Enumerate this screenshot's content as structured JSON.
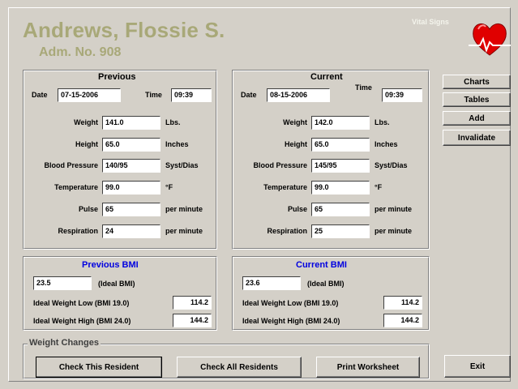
{
  "header": {
    "name": "Andrews, Flossie S.",
    "adm": "Adm. No. 908",
    "vital_signs": "Vital Signs"
  },
  "previous": {
    "title": "Previous",
    "date_label": "Date",
    "date": "07-15-2006",
    "time_label": "Time",
    "time": "09:39",
    "weight_label": "Weight",
    "weight": "141.0",
    "weight_unit": "Lbs.",
    "height_label": "Height",
    "height": "65.0",
    "height_unit": "Inches",
    "bp_label": "Blood Pressure",
    "bp": "140/95",
    "bp_unit": "Syst/Dias",
    "temp_label": "Temperature",
    "temp": "99.0",
    "temp_unit": "°F",
    "pulse_label": "Pulse",
    "pulse": "65",
    "pulse_unit": "per minute",
    "resp_label": "Respiration",
    "resp": "24",
    "resp_unit": "per minute"
  },
  "current": {
    "title": "Current",
    "date_label": "Date",
    "date": "08-15-2006",
    "time_label": "Time",
    "time": "09:39",
    "weight_label": "Weight",
    "weight": "142.0",
    "weight_unit": "Lbs.",
    "height_label": "Height",
    "height": "65.0",
    "height_unit": "Inches",
    "bp_label": "Blood Pressure",
    "bp": "145/95",
    "bp_unit": "Syst/Dias",
    "temp_label": "Temperature",
    "temp": "99.0",
    "temp_unit": "°F",
    "pulse_label": "Pulse",
    "pulse": "65",
    "pulse_unit": "per minute",
    "resp_label": "Respiration",
    "resp": "25",
    "resp_unit": "per minute"
  },
  "prev_bmi": {
    "title": "Previous BMI",
    "bmi": "23.5",
    "ideal_label": "(Ideal BMI)",
    "low_label": "Ideal Weight Low (BMI 19.0)",
    "low": "114.2",
    "high_label": "Ideal Weight High (BMI 24.0)",
    "high": "144.2"
  },
  "cur_bmi": {
    "title": "Current BMI",
    "bmi": "23.6",
    "ideal_label": "(Ideal BMI)",
    "low_label": "Ideal Weight Low (BMI 19.0)",
    "low": "114.2",
    "high_label": "Ideal Weight High (BMI 24.0)",
    "high": "144.2"
  },
  "side_buttons": {
    "charts": "Charts",
    "tables": "Tables",
    "add": "Add",
    "invalidate": "Invalidate",
    "exit": "Exit"
  },
  "weight_changes": {
    "legend": "Weight Changes",
    "check_this": "Check This Resident",
    "check_all": "Check All Residents",
    "print": "Print Worksheet"
  },
  "colors": {
    "background": "#d4d0c8",
    "name_color": "#a8a878",
    "bmi_title": "#0000e0",
    "heart": "#e00000"
  },
  "icons": {
    "heart": "heart-pulse-icon"
  }
}
